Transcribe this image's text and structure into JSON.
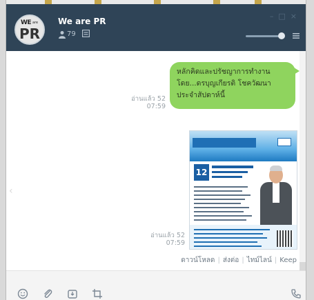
{
  "header": {
    "chat_name": "We are PR",
    "member_count": "79",
    "avatar_text": {
      "we": "WE",
      "are": "are",
      "pr": "PR"
    }
  },
  "messages": [
    {
      "type": "text",
      "lines": [
        "หลักคิดและปรัชญาการทำงาน",
        "โดย...ดรบุญเกียรติ โชควัฒนา",
        "ประจำสัปดาห์นี้"
      ],
      "read_status": "อ่านแล้ว 52",
      "time": "07:59"
    },
    {
      "type": "image",
      "poster_badge": "12",
      "read_status": "อ่านแล้ว 52",
      "time": "07:59"
    }
  ],
  "image_actions": [
    "ดาวน์โหลด",
    "ส่งต่อ",
    "ไทม์ไลน์",
    "Keep"
  ],
  "icons": {
    "member": "person-icon",
    "note": "note-icon",
    "menu": "menu-icon",
    "toolbar": [
      "emoji-icon",
      "attach-icon",
      "screenshot-icon",
      "crop-icon",
      "call-icon"
    ]
  },
  "colors": {
    "header_bg": "#2f4457",
    "bubble_bg": "#8fd45e",
    "toolbar_bg": "#f4f4f4"
  }
}
